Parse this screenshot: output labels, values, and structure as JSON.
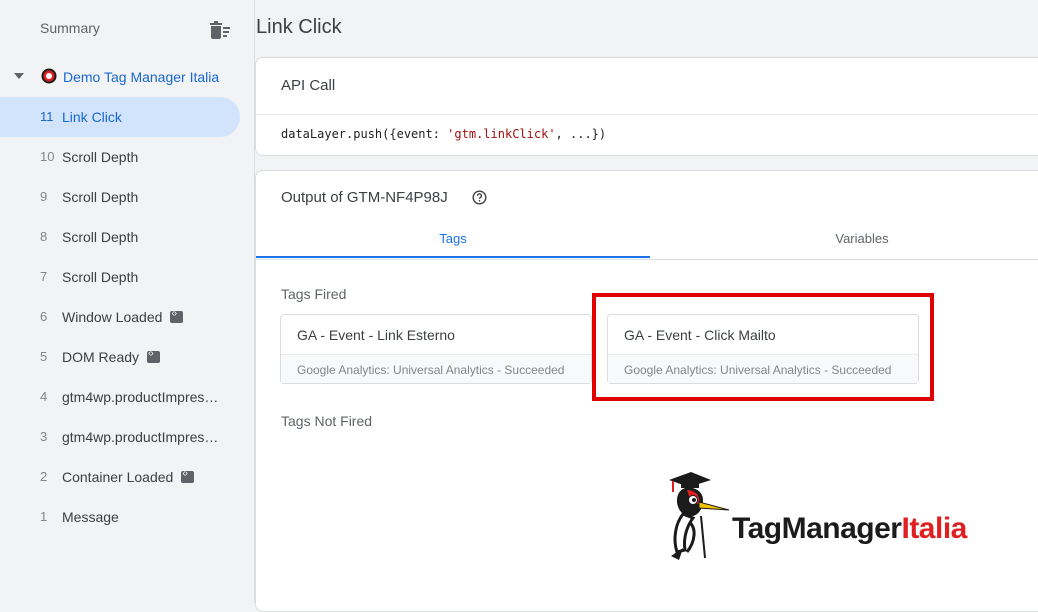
{
  "sidebar": {
    "summary_label": "Summary",
    "container_name": "Demo Tag Manager Italia",
    "events": [
      {
        "num": "11",
        "label": "Link Click",
        "active": true,
        "badge": false
      },
      {
        "num": "10",
        "label": "Scroll Depth",
        "badge": false
      },
      {
        "num": "9",
        "label": "Scroll Depth",
        "badge": false
      },
      {
        "num": "8",
        "label": "Scroll Depth",
        "badge": false
      },
      {
        "num": "7",
        "label": "Scroll Depth",
        "badge": false
      },
      {
        "num": "6",
        "label": "Window Loaded",
        "badge": true
      },
      {
        "num": "5",
        "label": "DOM Ready",
        "badge": true
      },
      {
        "num": "4",
        "label": "gtm4wp.productImpres…",
        "badge": false
      },
      {
        "num": "3",
        "label": "gtm4wp.productImpres…",
        "badge": false
      },
      {
        "num": "2",
        "label": "Container Loaded",
        "badge": true
      },
      {
        "num": "1",
        "label": "Message",
        "badge": false
      }
    ]
  },
  "main": {
    "title": "Link Click",
    "api_call": {
      "title": "API Call",
      "code_prefix": "dataLayer.push({event: ",
      "code_string": "'gtm.linkClick'",
      "code_suffix": ", ...})"
    },
    "output": {
      "title": "Output of GTM-NF4P98J",
      "tabs": [
        "Tags",
        "Variables"
      ],
      "active_tab": "Tags",
      "tags_fired_label": "Tags Fired",
      "tags_fired": [
        {
          "name": "GA - Event - Link Esterno",
          "status": "Google Analytics: Universal Analytics - Succeeded"
        },
        {
          "name": "GA - Event - Click Mailto",
          "status": "Google Analytics: Universal Analytics - Succeeded",
          "highlighted": true
        }
      ],
      "tags_not_fired_label": "Tags Not Fired"
    }
  },
  "logo": {
    "text_main": "TagManager",
    "text_accent": "Italia"
  },
  "colors": {
    "accent": "#1a73e8",
    "active_bg": "#d2e3fc",
    "highlight": "#e00000",
    "brand_red": "#e02020"
  }
}
